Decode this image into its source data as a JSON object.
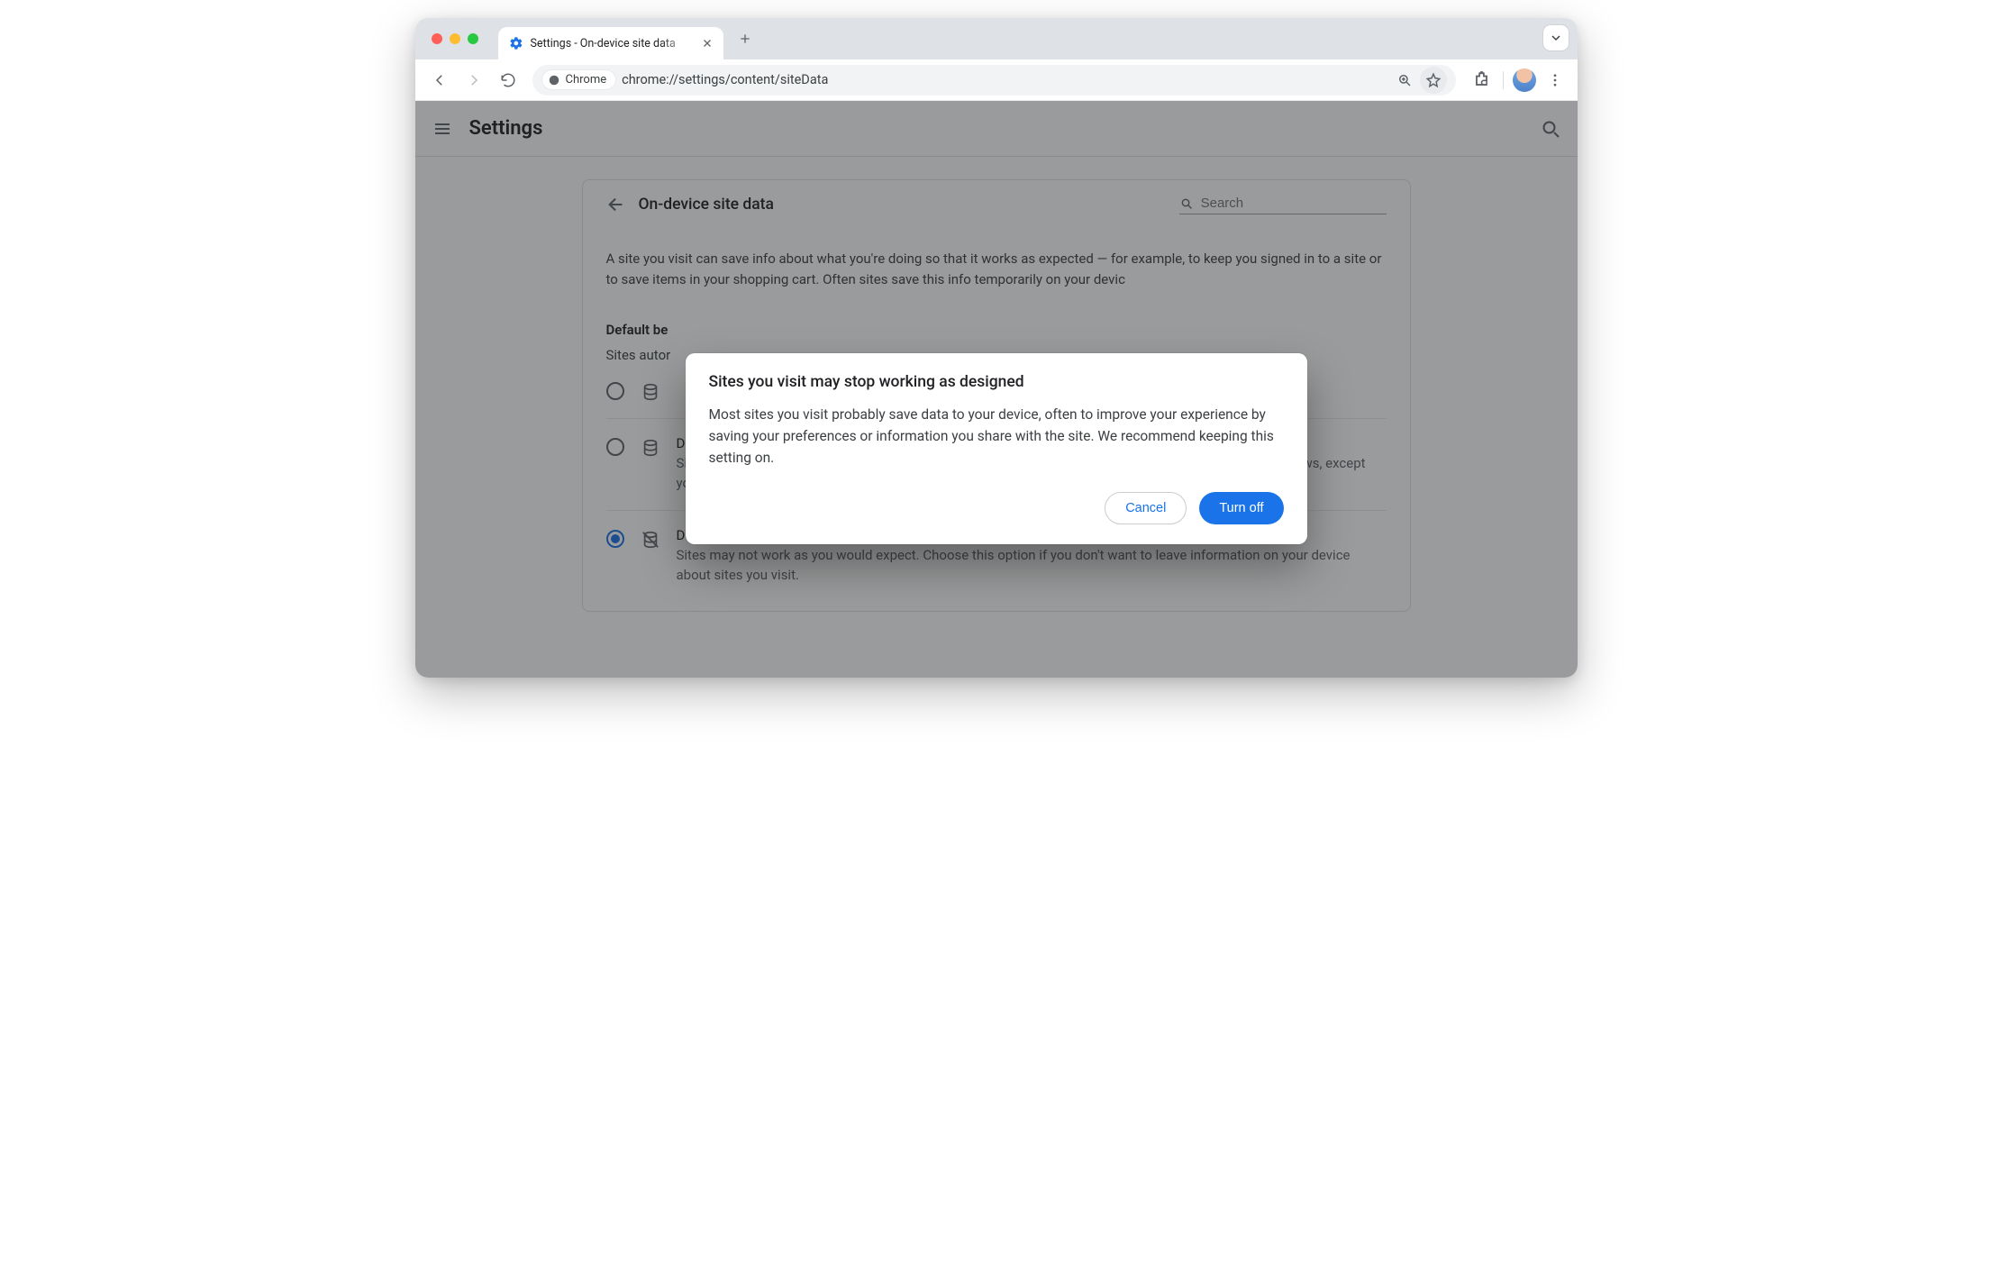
{
  "tab": {
    "title": "Settings - On-device site data"
  },
  "omnibox": {
    "chip_label": "Chrome",
    "url": "chrome://settings/content/siteData"
  },
  "settings_header": {
    "title": "Settings"
  },
  "page": {
    "back_label": "On-device site data",
    "search_placeholder": "Search",
    "description": "A site you visit can save info about what you're doing so that it works as expected — for example, to keep you signed in to a site or to save items in your shopping cart. Often sites save this info temporarily on your devic",
    "section_label": "Default be",
    "section_sub": "Sites autor"
  },
  "options": [
    {
      "selected": false,
      "icon": "data",
      "title": "",
      "sub": ""
    },
    {
      "selected": false,
      "icon": "data",
      "title": "Delete data sites have saved to your device when you close all windows",
      "sub": "Sites will probably work as expected. You'll be signed out of most sites when you close all Chrome windows, except your Google Account if you're signed in to Chrome."
    },
    {
      "selected": true,
      "icon": "data-off",
      "title": "Don't allow sites to save data on your device (not recommended)",
      "sub": "Sites may not work as you would expect. Choose this option if you don't want to leave information on your device about sites you visit."
    }
  ],
  "modal": {
    "title": "Sites you visit may stop working as designed",
    "body": "Most sites you visit probably save data to your device, often to improve your experience by saving your preferences or information you share with the site. We recommend keeping this setting on.",
    "cancel": "Cancel",
    "confirm": "Turn off"
  }
}
